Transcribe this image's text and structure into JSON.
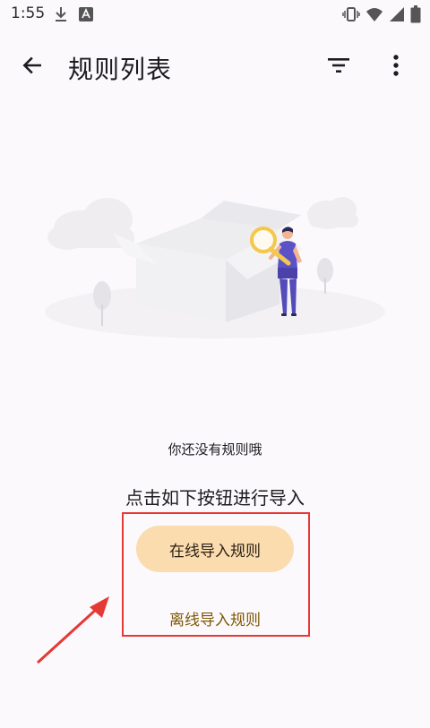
{
  "status_bar": {
    "time": "1:55"
  },
  "app_bar": {
    "title": "规则列表"
  },
  "icons": {
    "back": "arrow-back-icon",
    "filter": "filter-icon",
    "more": "more-vert-icon",
    "download": "download-icon",
    "app_notification": "android-notification-icon",
    "vibrate": "vibrate-icon",
    "wifi": "wifi-icon",
    "signal": "signal-icon",
    "battery": "battery-icon"
  },
  "empty_state": {
    "message": "你还没有规则哦",
    "hint": "点击如下按钮进行导入"
  },
  "actions": {
    "online_import_label": "在线导入规则",
    "offline_import_label": "离线导入规则"
  },
  "colors": {
    "background": "#fcf9fd",
    "primary_button": "#fbdcae",
    "link_text": "#7e5700",
    "highlight": "#e53935"
  }
}
